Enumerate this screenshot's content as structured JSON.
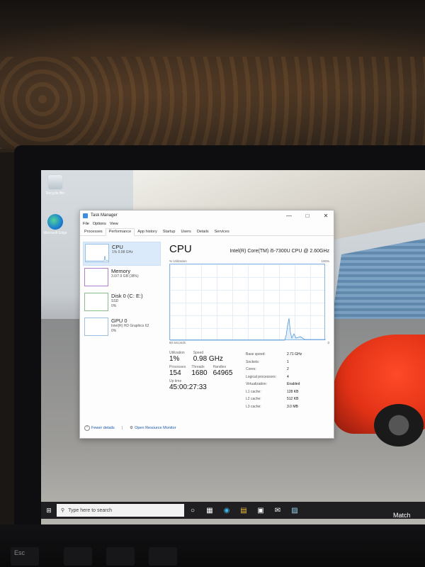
{
  "desktop": {
    "icons": [
      {
        "label": "Recycle Bin",
        "icon": "recycle-bin-icon"
      },
      {
        "label": "Microsoft Edge",
        "icon": "edge-icon"
      }
    ]
  },
  "taskbar": {
    "search_placeholder": "Type here to search"
  },
  "keyboard": {
    "esc": "Esc",
    "match": "Match"
  },
  "taskmanager": {
    "title": "Task Manager",
    "menu": [
      "File",
      "Options",
      "View"
    ],
    "tabs": [
      "Processes",
      "Performance",
      "App history",
      "Startup",
      "Users",
      "Details",
      "Services"
    ],
    "active_tab": "Performance",
    "resources": [
      {
        "name": "CPU",
        "sub1": "1% 0.98 GHz",
        "sub2": ""
      },
      {
        "name": "Memory",
        "sub1": "3.0/7.9 GB (38%)",
        "sub2": ""
      },
      {
        "name": "Disk 0 (C: E:)",
        "sub1": "SSD",
        "sub2": "0%"
      },
      {
        "name": "GPU 0",
        "sub1": "Intel(R) HD Graphics 62",
        "sub2": "0%"
      }
    ],
    "detail": {
      "title": "CPU",
      "model": "Intel(R) Core(TM) i5-7300U CPU @ 2.60GHz",
      "graph_label_left": "% Utilization",
      "graph_label_right": "100%",
      "graph_foot_left": "60 seconds",
      "graph_foot_right": "0",
      "utilization_label": "Utilization",
      "utilization": "1%",
      "speed_label": "Speed",
      "speed": "0.98 GHz",
      "processes_label": "Processes",
      "processes": "154",
      "threads_label": "Threads",
      "threads": "1680",
      "handles_label": "Handles",
      "handles": "64965",
      "uptime_label": "Up time",
      "uptime": "45:00:27:33",
      "properties": [
        {
          "k": "Base speed:",
          "v": "2.71 GHz"
        },
        {
          "k": "Sockets:",
          "v": "1"
        },
        {
          "k": "Cores:",
          "v": "2"
        },
        {
          "k": "Logical processors:",
          "v": "4"
        },
        {
          "k": "Virtualization:",
          "v": "Enabled"
        },
        {
          "k": "L1 cache:",
          "v": "128 KB"
        },
        {
          "k": "L2 cache:",
          "v": "512 KB"
        },
        {
          "k": "L3 cache:",
          "v": "3.0 MB"
        }
      ]
    },
    "footer": {
      "fewer_details": "Fewer details",
      "open_resource_monitor": "Open Resource Monitor"
    }
  }
}
